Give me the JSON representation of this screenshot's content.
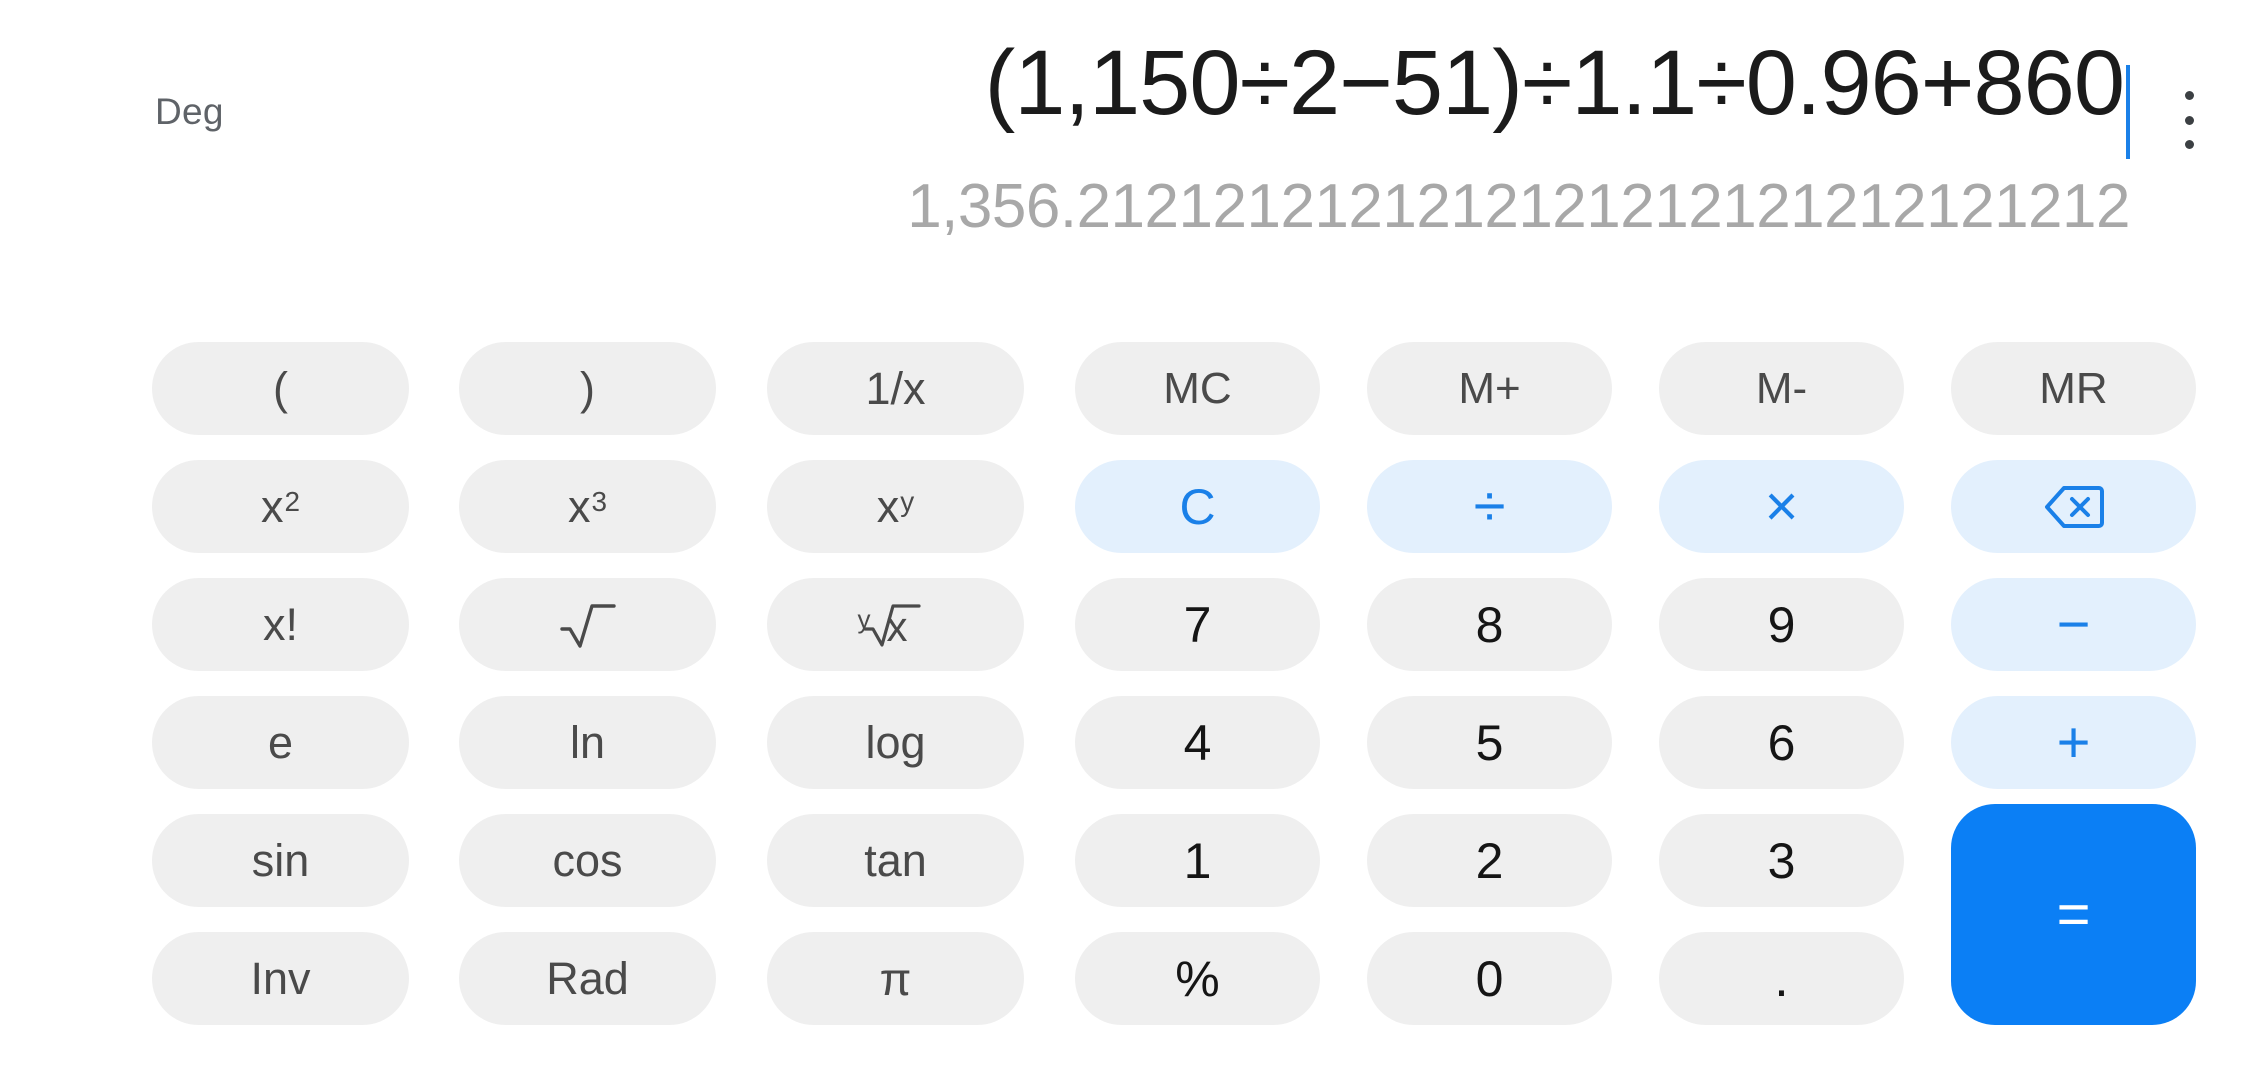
{
  "display": {
    "angle_mode": "Deg",
    "expression": "(1,150÷2−51)÷1.1÷0.96+860",
    "result": "1,356.2121212121212121212121212121212",
    "overflow_menu_icon": "more-vert-icon",
    "cursor_color": "#1a80e8"
  },
  "colors": {
    "key_bg": "#efefef",
    "op_bg": "#e3f0fd",
    "op_fg": "#1a80e8",
    "equals_bg": "#0b7ff5",
    "equals_fg": "#ffffff",
    "func_fg": "#4a4a4a",
    "num_fg": "#151515",
    "result_fg": "#a8a8a8",
    "expression_fg": "#1b1b1b",
    "page_bg": "#ffffff"
  },
  "keypad": {
    "rows": [
      {
        "keys": [
          {
            "label": "(",
            "name": "key-open-paren",
            "kind": "func"
          },
          {
            "label": ")",
            "name": "key-close-paren",
            "kind": "func"
          },
          {
            "label": "1/x",
            "name": "key-reciprocal",
            "kind": "func"
          },
          {
            "label": "MC",
            "name": "key-memory-clear",
            "kind": "mem"
          },
          {
            "label": "M+",
            "name": "key-memory-add",
            "kind": "mem"
          },
          {
            "label": "M-",
            "name": "key-memory-subtract",
            "kind": "mem"
          },
          {
            "label": "MR",
            "name": "key-memory-recall",
            "kind": "mem"
          }
        ]
      },
      {
        "keys": [
          {
            "label": "x2",
            "name": "key-square",
            "kind": "func-sup",
            "base": "x",
            "sup": "2"
          },
          {
            "label": "x3",
            "name": "key-cube",
            "kind": "func-sup",
            "base": "x",
            "sup": "3"
          },
          {
            "label": "xy",
            "name": "key-power",
            "kind": "func-sup",
            "base": "x",
            "sup": "y"
          },
          {
            "label": "C",
            "name": "key-clear",
            "kind": "op"
          },
          {
            "label": "÷",
            "name": "key-divide",
            "kind": "op"
          },
          {
            "label": "×",
            "name": "key-multiply",
            "kind": "op"
          },
          {
            "label": "backspace",
            "name": "key-backspace",
            "kind": "op-icon",
            "icon": "backspace-icon"
          }
        ]
      },
      {
        "keys": [
          {
            "label": "x!",
            "name": "key-factorial",
            "kind": "func"
          },
          {
            "label": "√",
            "name": "key-square-root",
            "kind": "func-icon",
            "icon": "sqrt-icon"
          },
          {
            "label": "y√x",
            "name": "key-nth-root",
            "kind": "func-icon",
            "icon": "nth-root-icon"
          },
          {
            "label": "7",
            "name": "key-7",
            "kind": "num"
          },
          {
            "label": "8",
            "name": "key-8",
            "kind": "num"
          },
          {
            "label": "9",
            "name": "key-9",
            "kind": "num"
          },
          {
            "label": "−",
            "name": "key-subtract",
            "kind": "op"
          }
        ]
      },
      {
        "keys": [
          {
            "label": "e",
            "name": "key-euler",
            "kind": "func"
          },
          {
            "label": "ln",
            "name": "key-natural-log",
            "kind": "func"
          },
          {
            "label": "log",
            "name": "key-log",
            "kind": "func"
          },
          {
            "label": "4",
            "name": "key-4",
            "kind": "num"
          },
          {
            "label": "5",
            "name": "key-5",
            "kind": "num"
          },
          {
            "label": "6",
            "name": "key-6",
            "kind": "num"
          },
          {
            "label": "+",
            "name": "key-add",
            "kind": "op"
          }
        ]
      },
      {
        "keys": [
          {
            "label": "sin",
            "name": "key-sin",
            "kind": "func"
          },
          {
            "label": "cos",
            "name": "key-cos",
            "kind": "func"
          },
          {
            "label": "tan",
            "name": "key-tan",
            "kind": "func"
          },
          {
            "label": "1",
            "name": "key-1",
            "kind": "num"
          },
          {
            "label": "2",
            "name": "key-2",
            "kind": "num"
          },
          {
            "label": "3",
            "name": "key-3",
            "kind": "num"
          },
          {
            "label": "=",
            "name": "key-equals",
            "kind": "equals"
          }
        ]
      },
      {
        "keys": [
          {
            "label": "Inv",
            "name": "key-inverse",
            "kind": "func"
          },
          {
            "label": "Rad",
            "name": "key-radian-mode",
            "kind": "func"
          },
          {
            "label": "π",
            "name": "key-pi",
            "kind": "func"
          },
          {
            "label": "%",
            "name": "key-percent",
            "kind": "num"
          },
          {
            "label": "0",
            "name": "key-0",
            "kind": "num"
          },
          {
            "label": ".",
            "name": "key-decimal",
            "kind": "num"
          }
        ]
      }
    ]
  }
}
